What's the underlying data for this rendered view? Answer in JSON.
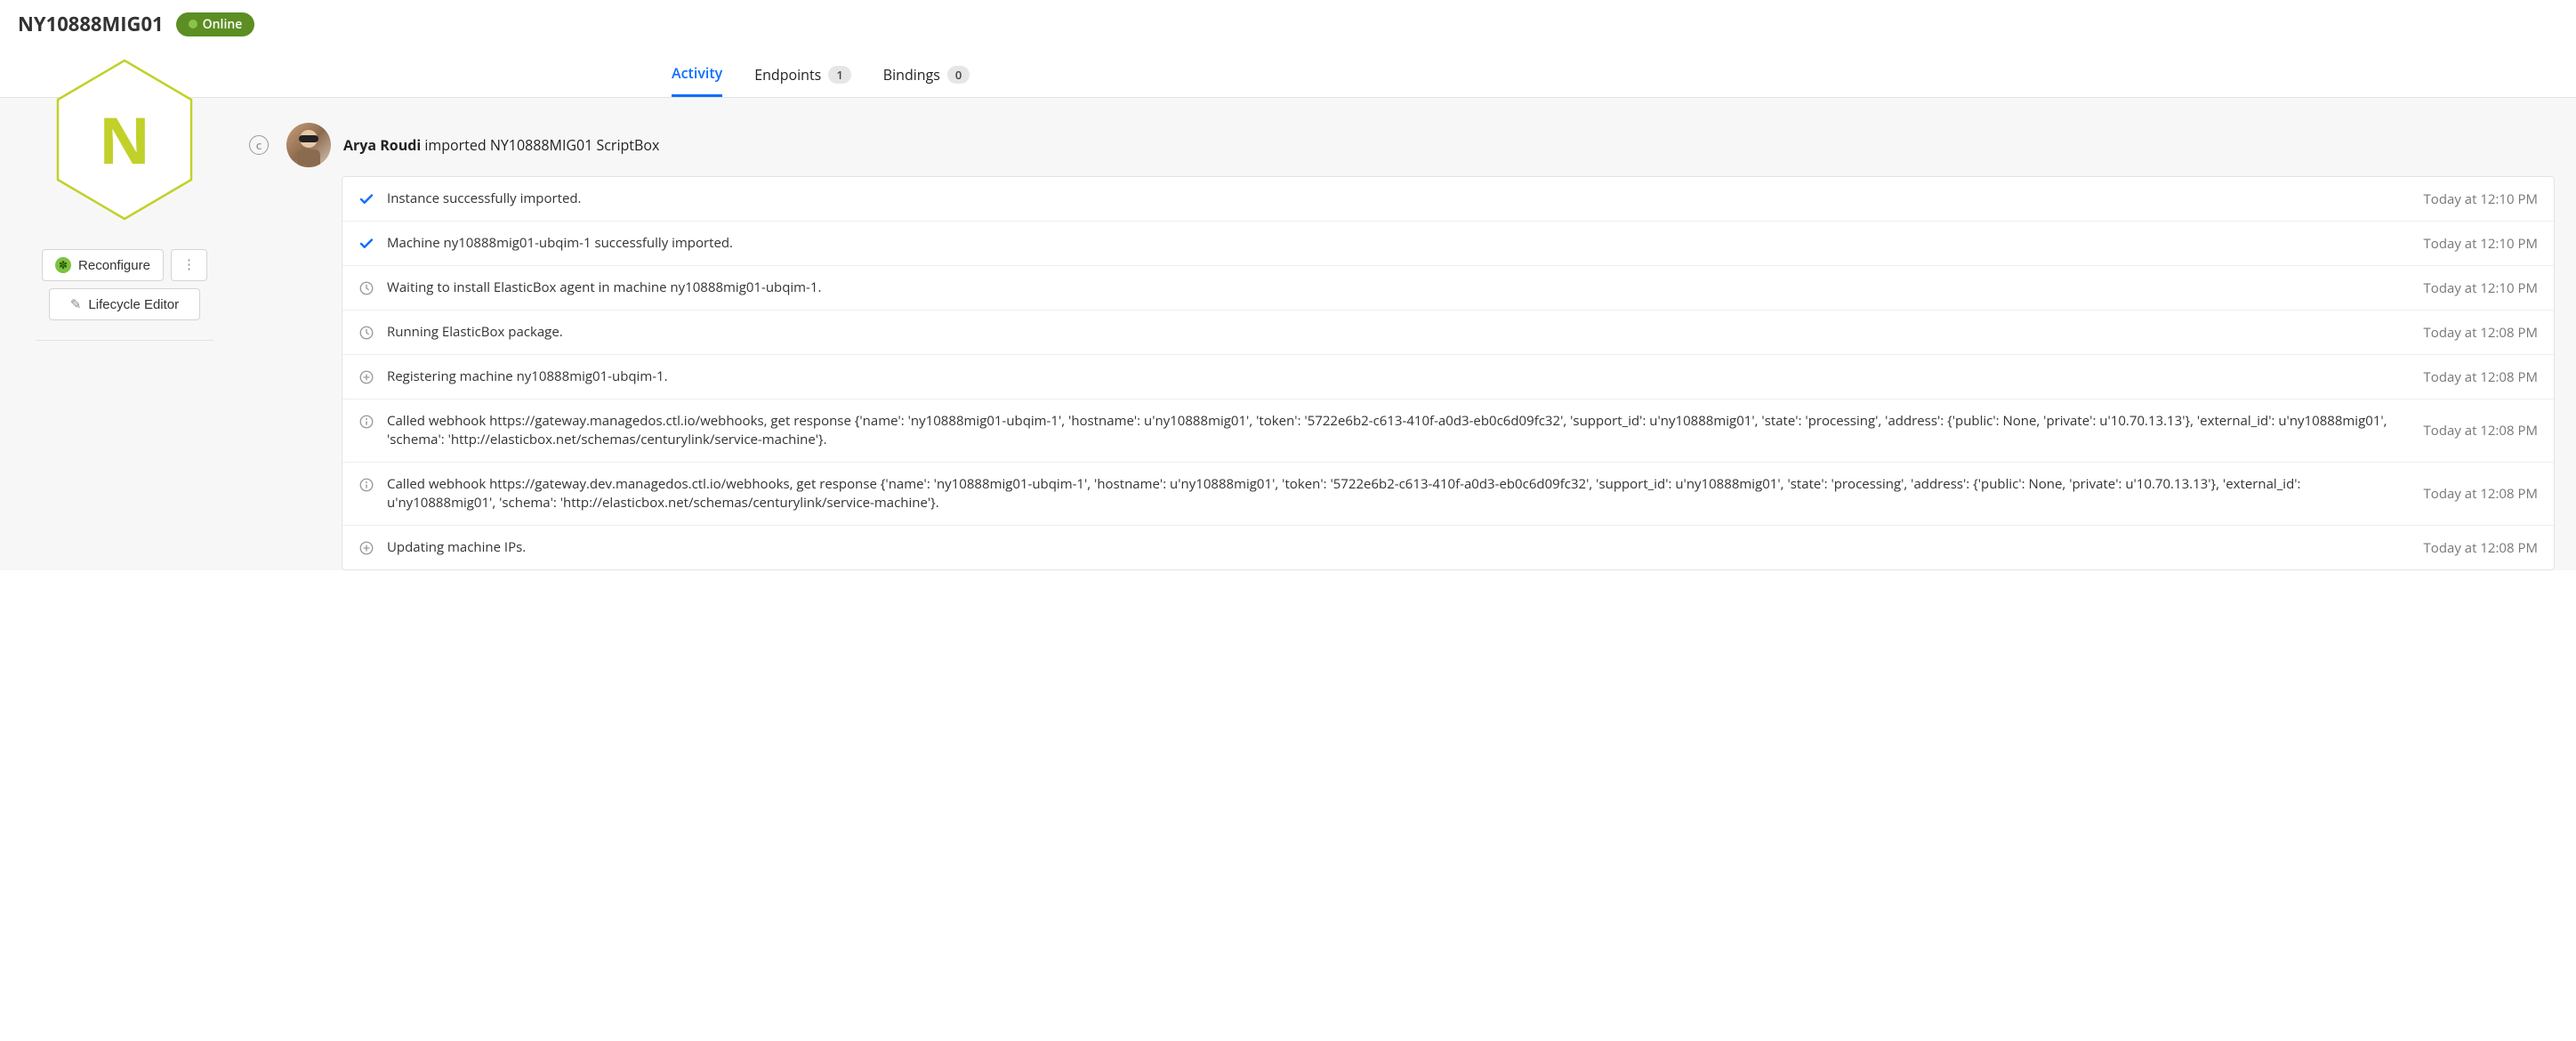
{
  "header": {
    "instance_name": "NY10888MIG01",
    "status_label": "Online"
  },
  "tabs": [
    {
      "label": "Activity",
      "count": null,
      "active": true
    },
    {
      "label": "Endpoints",
      "count": "1",
      "active": false
    },
    {
      "label": "Bindings",
      "count": "0",
      "active": false
    }
  ],
  "left": {
    "hex_letter": "N",
    "reconfigure_label": "Reconfigure",
    "lifecycle_label": "Lifecycle Editor"
  },
  "feed": {
    "user_name": "Arya Roudi",
    "action_text": "imported",
    "object_text": "NY10888MIG01 ScriptBox",
    "rows": [
      {
        "icon": "check",
        "msg": "Instance successfully imported.",
        "time": "Today at 12:10 PM"
      },
      {
        "icon": "check",
        "msg": "Machine ny10888mig01-ubqim-1 successfully imported.",
        "time": "Today at 12:10 PM"
      },
      {
        "icon": "clock",
        "msg": "Waiting to install ElasticBox agent in machine ny10888mig01-ubqim-1.",
        "time": "Today at 12:10 PM"
      },
      {
        "icon": "clock",
        "msg": "Running ElasticBox package.",
        "time": "Today at 12:08 PM"
      },
      {
        "icon": "plus",
        "msg": "Registering machine ny10888mig01-ubqim-1.",
        "time": "Today at 12:08 PM"
      },
      {
        "icon": "info",
        "msg": "Called webhook https://gateway.managedos.ctl.io/webhooks, get response {'name': 'ny10888mig01-ubqim-1', 'hostname': u'ny10888mig01', 'token': '5722e6b2-c613-410f-a0d3-eb0c6d09fc32', 'support_id': u'ny10888mig01', 'state': 'processing', 'address': {'public': None, 'private': u'10.70.13.13'}, 'external_id': u'ny10888mig01', 'schema': 'http://elasticbox.net/schemas/centurylink/service-machine'}.",
        "time": "Today at 12:08 PM"
      },
      {
        "icon": "info",
        "msg": "Called webhook https://gateway.dev.managedos.ctl.io/webhooks, get response {'name': 'ny10888mig01-ubqim-1', 'hostname': u'ny10888mig01', 'token': '5722e6b2-c613-410f-a0d3-eb0c6d09fc32', 'support_id': u'ny10888mig01', 'state': 'processing', 'address': {'public': None, 'private': u'10.70.13.13'}, 'external_id': u'ny10888mig01', 'schema': 'http://elasticbox.net/schemas/centurylink/service-machine'}.",
        "time": "Today at 12:08 PM"
      },
      {
        "icon": "plus",
        "msg": "Updating machine IPs.",
        "time": "Today at 12:08 PM"
      }
    ]
  }
}
